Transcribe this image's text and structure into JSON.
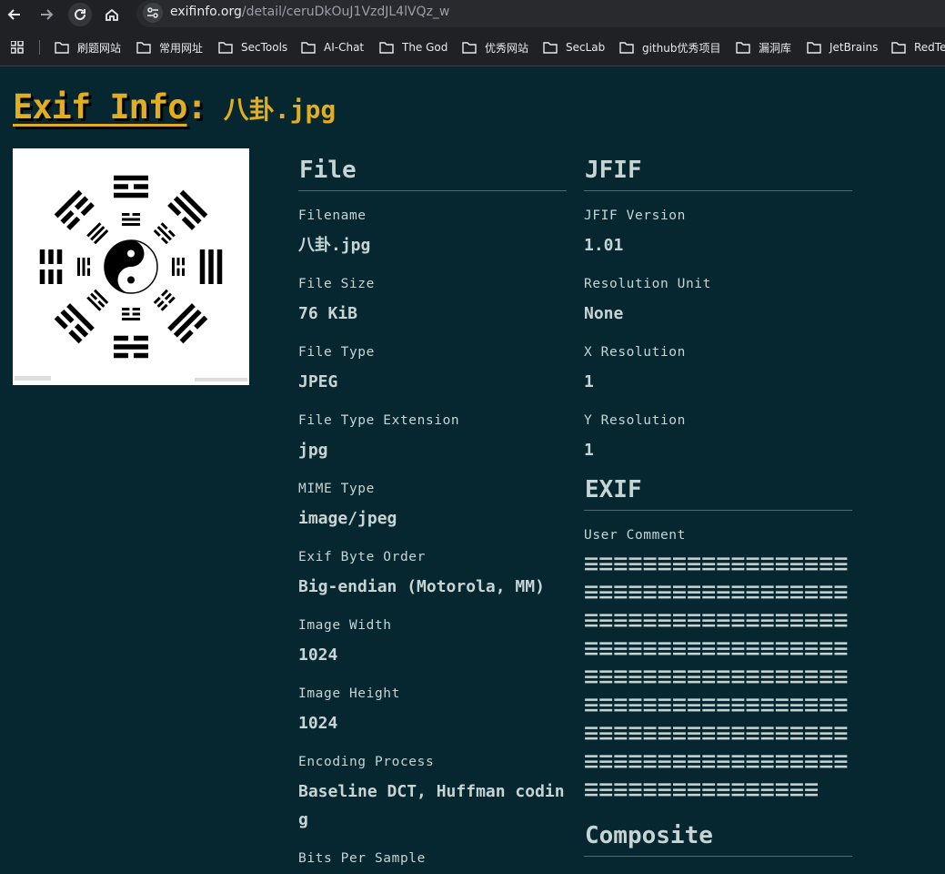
{
  "browser": {
    "url_host": "exifinfo.org",
    "url_path": "/detail/ceruDkOuJ1VzdJL4lVQz_w",
    "bookmarks": [
      "刷题网站",
      "常用网址",
      "SecTools",
      "AI-Chat",
      "The God",
      "优秀网站",
      "SecLab",
      "github优秀项目",
      "漏洞库",
      "JetBrains",
      "RedTe"
    ]
  },
  "page": {
    "title_main": "Exif Info",
    "title_colon": ":",
    "title_filename": "八卦.jpg"
  },
  "sections": {
    "file": {
      "heading": "File",
      "fields": [
        {
          "label": "Filename",
          "value": "八卦.jpg"
        },
        {
          "label": "File Size",
          "value": "76 KiB"
        },
        {
          "label": "File Type",
          "value": "JPEG"
        },
        {
          "label": "File Type Extension",
          "value": "jpg"
        },
        {
          "label": "MIME Type",
          "value": "image/jpeg"
        },
        {
          "label": "Exif Byte Order",
          "value": "Big-endian (Motorola, MM)"
        },
        {
          "label": "Image Width",
          "value": "1024"
        },
        {
          "label": "Image Height",
          "value": "1024"
        },
        {
          "label": "Encoding Process",
          "value": "Baseline DCT, Huffman coding"
        },
        {
          "label": "Bits Per Sample",
          "value": ""
        }
      ]
    },
    "jfif": {
      "heading": "JFIF",
      "fields": [
        {
          "label": "JFIF Version",
          "value": "1.01"
        },
        {
          "label": "Resolution Unit",
          "value": "None"
        },
        {
          "label": "X Resolution",
          "value": "1"
        },
        {
          "label": "Y Resolution",
          "value": "1"
        }
      ]
    },
    "exif": {
      "heading": "EXIF",
      "fields": [
        {
          "label": "User Comment",
          "value": "☰☰☰☰☰☰☰☰☰☰☰☰☰☰☰☰☰☰☰☰☰☰☰☰☰☰☰☰☰☰☰☰☰☰☰☰☰☰☰☰☰☰☰☰☰☰☰☰☰☰☰☰☰☰☰☰☰☰☰☰☰☰☰☰☰☰☰☰☰☰☰☰☰☰☰☰☰☰☰☰☰☰☰☰☰☰☰☰☰☰☰☰☰☰☰☰☰☰☰☰☰☰☰☰☰☰☰☰☰☰☰☰☰☰☰☰☰☰☰☰☰☰☰☰☰☰☰☰☰☰☰☰☰☰☰☰☰☰☰☰☰☰☰☰☰☰☰☰☰☰☰☰☰☰☰☰☰☰☰☰"
        }
      ]
    },
    "composite": {
      "heading": "Composite"
    }
  }
}
